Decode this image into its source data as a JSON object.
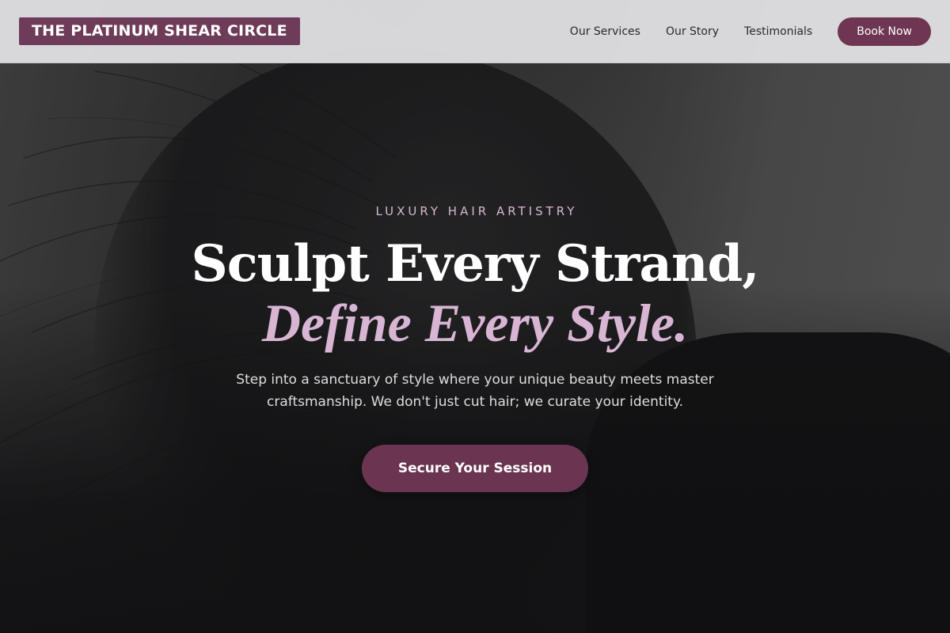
{
  "header": {
    "logo": "THE PLATINUM SHEAR CIRCLE",
    "nav": [
      "Our Services",
      "Our Story",
      "Testimonials"
    ],
    "cta": "Book Now"
  },
  "hero": {
    "eyebrow": "LUXURY HAIR ARTISTRY",
    "headline_line1": "Sculpt Every Strand,",
    "headline_line2": "Define Every Style.",
    "subtext": "Step into a sanctuary of style where your unique beauty meets master craftsmanship. We don't just cut hair; we curate your identity.",
    "cta": "Secure Your Session",
    "background_image": "woman-with-windswept-dark-hair"
  },
  "colors": {
    "brand": "#6e3c58",
    "accent_light": "#d7b5d3",
    "header_bg": "#e4e4e6"
  }
}
